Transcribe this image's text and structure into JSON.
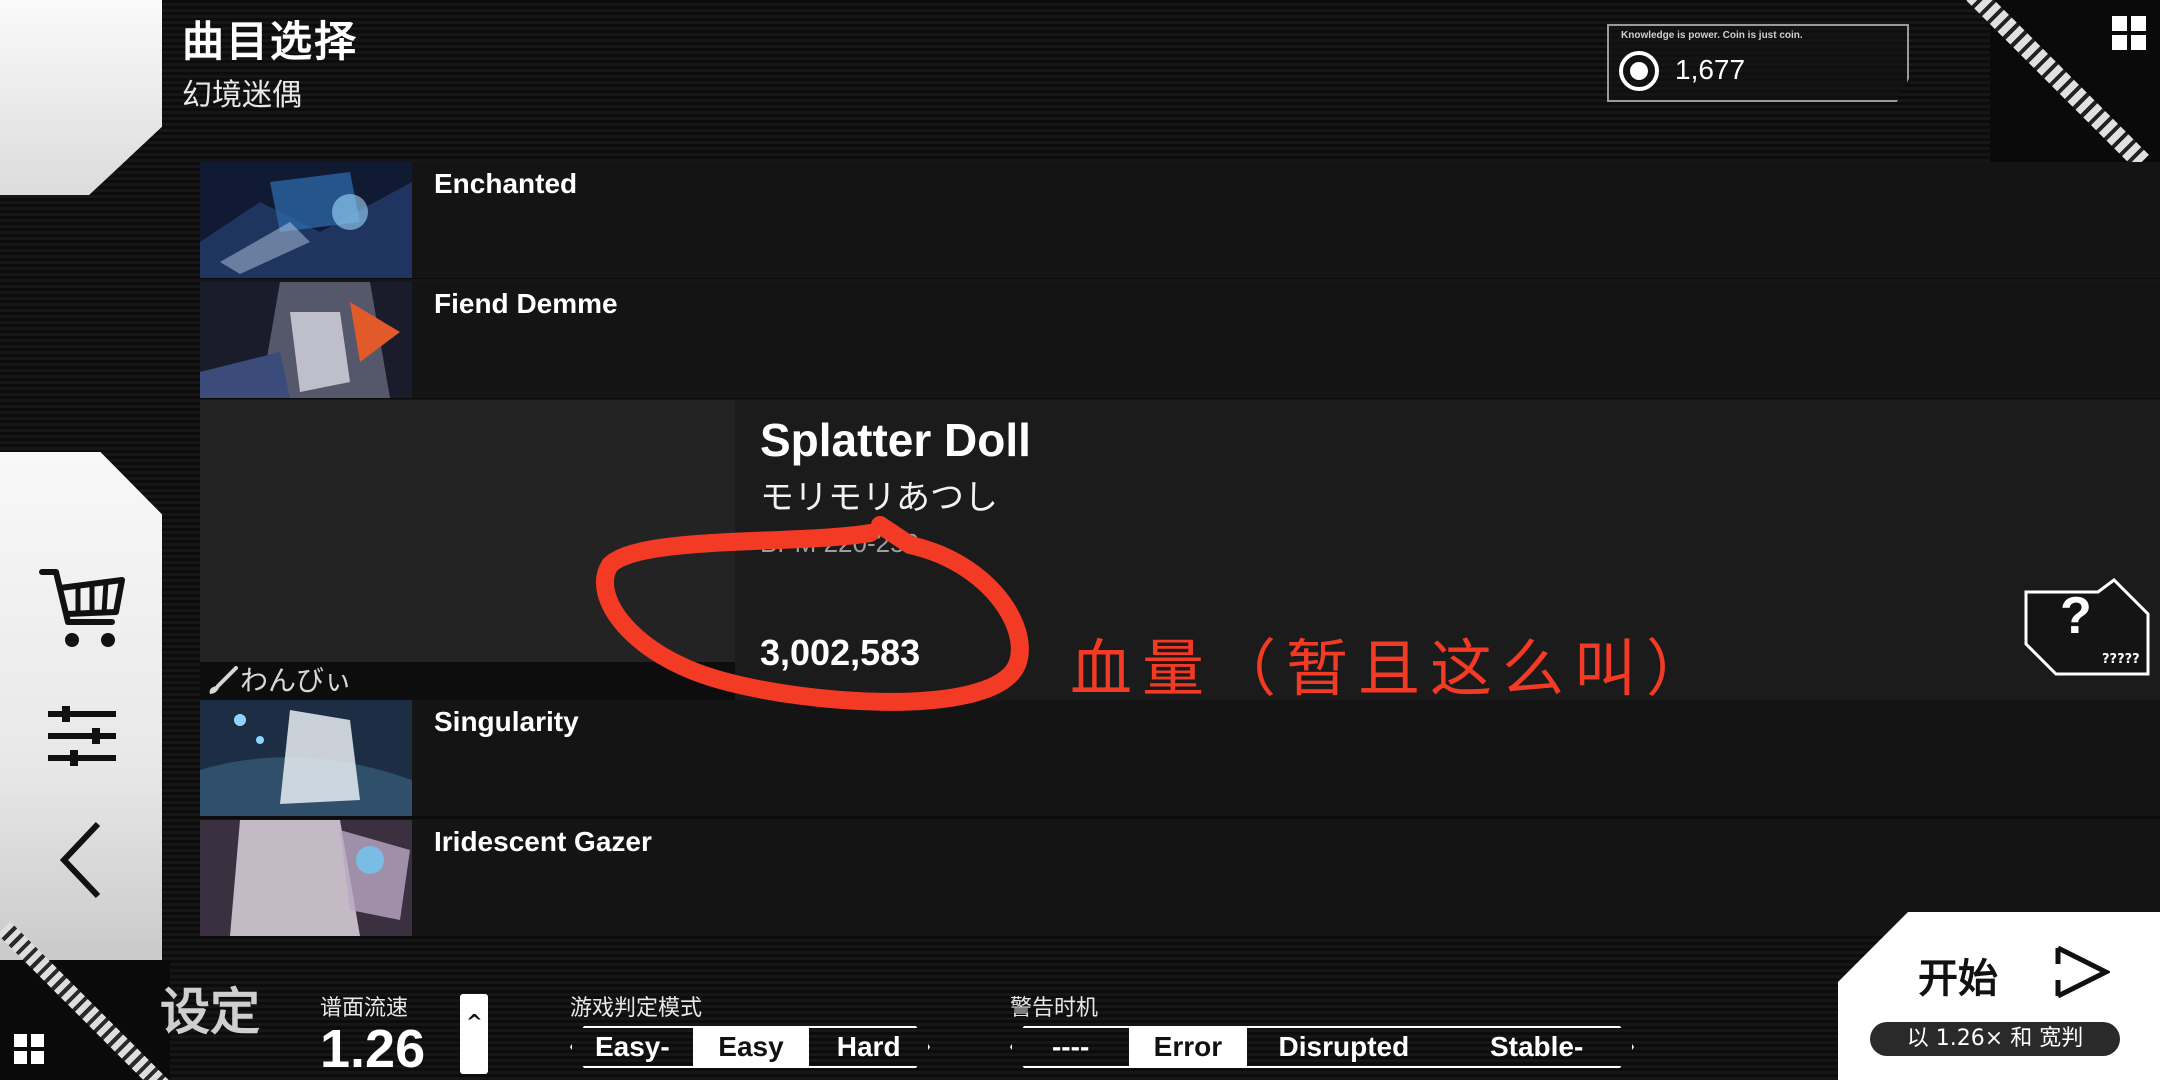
{
  "header": {
    "title": "曲目选择",
    "subtitle": "幻境迷偶"
  },
  "coins": {
    "tagline": "Knowledge is power. Coin is just coin.",
    "value": "1,677",
    "icon": "coin-icon"
  },
  "songs": [
    {
      "name": "Enchanted"
    },
    {
      "name": "Fiend Demme"
    },
    {
      "name": "Singularity"
    },
    {
      "name": "Iridescent Gazer"
    }
  ],
  "selected": {
    "title": "Splatter Doll",
    "artist": "モリモリあつし",
    "bpm": "BPM 220-250",
    "hp": "3,002,583",
    "composer_tag": "わんびぃ"
  },
  "difficulty_badge": {
    "symbol": "?",
    "label": "?????"
  },
  "annotation": {
    "text": "血量（暂且这么叫）",
    "color": "#f23a24"
  },
  "nav": {
    "icons": [
      "cart-icon",
      "sliders-icon",
      "back-icon"
    ]
  },
  "bottom": {
    "settings_label": "设定",
    "speed_label": "谱面流速",
    "speed_value": "1.26",
    "judge_label": "游戏判定模式",
    "judge_options": [
      "Easy-",
      "Easy",
      "Hard"
    ],
    "judge_selected": "Easy",
    "warn_label": "警告时机",
    "warn_options": [
      "----",
      "Error",
      "Disrupted",
      "Stable-"
    ],
    "warn_selected": "Error"
  },
  "start": {
    "label": "开始",
    "sub": "以 1.26× 和 宽判"
  },
  "colors": {
    "background": "#0e0e0e",
    "panel": "#1b1b1b",
    "accent_white": "#ffffff",
    "annotation_red": "#f23a24"
  }
}
